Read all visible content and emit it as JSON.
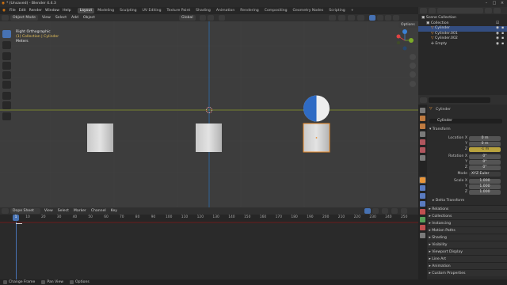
{
  "titlebar": {
    "title": "* (Unsaved) - Blender 4.4.3"
  },
  "menubar": {
    "menus": [
      "File",
      "Edit",
      "Render",
      "Window",
      "Help"
    ],
    "workspaces": [
      "Layout",
      "Modeling",
      "Sculpting",
      "UV Editing",
      "Texture Paint",
      "Shading",
      "Animation",
      "Rendering",
      "Compositing",
      "Geometry Nodes",
      "Scripting"
    ],
    "active_workspace": "Layout",
    "scene": "Scene",
    "view_layer": "ViewLayer"
  },
  "viewport": {
    "mode": "Object Mode",
    "menus": [
      "View",
      "Select",
      "Add",
      "Object"
    ],
    "orientation": "Global",
    "options": "Options",
    "view_name": "Right Orthographic",
    "collection_path": "(1) Collection | Cylinder",
    "units": "Meters"
  },
  "timeline": {
    "editor": "Dope Sheet",
    "menus": [
      "View",
      "Select",
      "Marker",
      "Channel",
      "Key"
    ],
    "current_frame": "1",
    "ticks": [
      "10",
      "20",
      "30",
      "40",
      "50",
      "60",
      "70",
      "80",
      "90",
      "100",
      "110",
      "120",
      "130",
      "140",
      "150",
      "160",
      "170",
      "180",
      "190",
      "200",
      "210",
      "220",
      "230",
      "240",
      "250"
    ]
  },
  "statusbar": {
    "items": [
      "Change Frame",
      "Pan View",
      "Options"
    ]
  },
  "outliner": {
    "search_placeholder": "",
    "rows": [
      {
        "label": "Scene Collection",
        "indent": 0,
        "selected": false
      },
      {
        "label": "Collection",
        "indent": 1,
        "selected": false
      },
      {
        "label": "Cylinder",
        "indent": 2,
        "selected": true
      },
      {
        "label": "Cylinder.001",
        "indent": 2,
        "selected": false
      },
      {
        "label": "Cylinder.002",
        "indent": 2,
        "selected": false
      },
      {
        "label": "Empty",
        "indent": 2,
        "selected": false
      }
    ]
  },
  "properties": {
    "object_name": "Cylinder",
    "name_field": "Cylinder",
    "transform_label": "Transform",
    "location": {
      "label": "Location X",
      "x": "0 m",
      "y": "0 m",
      "z": "-1 m",
      "y_label": "Y",
      "z_label": "Z"
    },
    "rotation": {
      "label": "Rotation X",
      "x": "0°",
      "y": "0°",
      "z": "0°",
      "y_label": "Y",
      "z_label": "Z"
    },
    "mode": {
      "label": "Mode",
      "value": "XYZ Euler"
    },
    "scale": {
      "label": "Scale X",
      "x": "1.000",
      "y": "1.000",
      "z": "1.000",
      "y_label": "Y",
      "z_label": "Z"
    },
    "delta_label": "Delta Transform",
    "panels": [
      "Relations",
      "Collections",
      "Instancing",
      "Motion Paths",
      "Shading",
      "Visibility",
      "Viewport Display",
      "Line Art",
      "Animation",
      "Custom Properties"
    ]
  },
  "colors": {
    "accent": "#4772b3",
    "selected_outline": "#e88a2c",
    "animated_field": "#b8a23e",
    "x_axis": "#8b9a2a",
    "y_axis": "#2e6fb0"
  }
}
